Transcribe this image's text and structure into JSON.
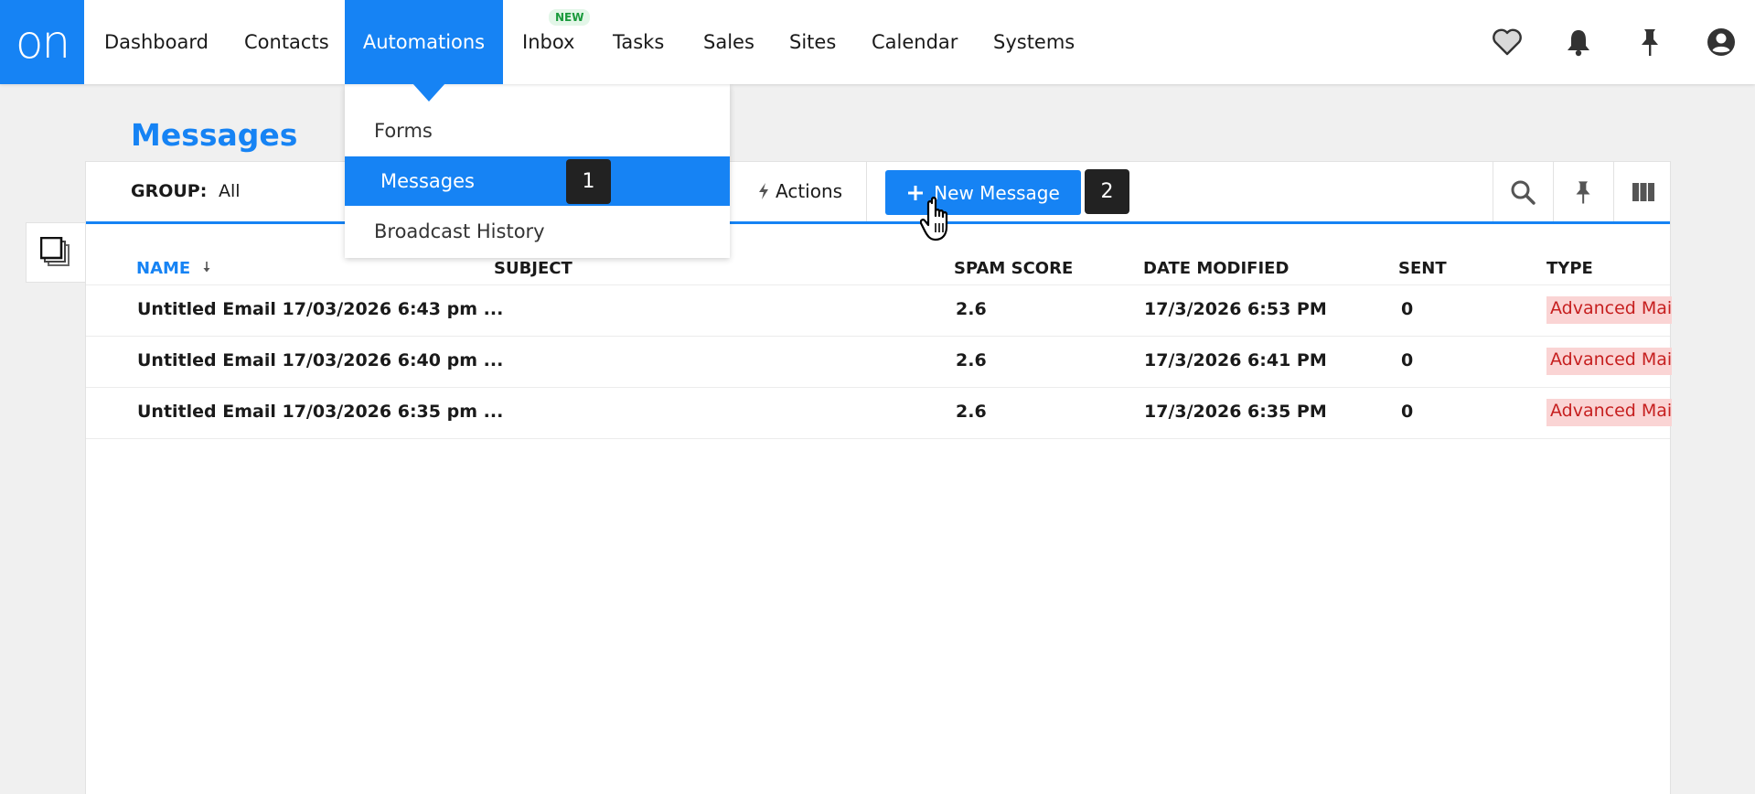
{
  "logo": {
    "text": "on"
  },
  "nav": {
    "items": [
      {
        "label": "Dashboard"
      },
      {
        "label": "Contacts"
      },
      {
        "label": "Automations"
      },
      {
        "label": "Inbox",
        "badge": "NEW"
      },
      {
        "label": "Tasks"
      },
      {
        "label": "Sales"
      },
      {
        "label": "Sites"
      },
      {
        "label": "Calendar"
      },
      {
        "label": "Systems"
      }
    ],
    "active": "Automations"
  },
  "top_icons": [
    "heart-icon",
    "bell-icon",
    "pin-icon",
    "account-icon"
  ],
  "dropdown": {
    "items": [
      {
        "label": "Forms"
      },
      {
        "label": "Messages"
      },
      {
        "label": "Broadcast History"
      }
    ],
    "active": "Messages"
  },
  "page": {
    "title": "Messages"
  },
  "toolbar": {
    "group_label": "GROUP:",
    "group_value": "All",
    "actions_label": "Actions",
    "new_message_label": "New Message"
  },
  "step_badges": {
    "one": "1",
    "two": "2"
  },
  "table": {
    "columns": [
      "NAME",
      "SUBJECT",
      "SPAM SCORE",
      "DATE MODIFIED",
      "SENT",
      "TYPE"
    ],
    "sorted_column": "NAME",
    "rows": [
      {
        "name": "Untitled Email 17/03/2026 6:43 pm ...",
        "subject": "",
        "spam_score": "2.6",
        "date_modified": "17/3/2026 6:53 PM",
        "sent": "0",
        "type": "Advanced Mail"
      },
      {
        "name": "Untitled Email 17/03/2026 6:40 pm ...",
        "subject": "",
        "spam_score": "2.6",
        "date_modified": "17/3/2026 6:41 PM",
        "sent": "0",
        "type": "Advanced Mail"
      },
      {
        "name": "Untitled Email 17/03/2026 6:35 pm ...",
        "subject": "",
        "spam_score": "2.6",
        "date_modified": "17/3/2026 6:35 PM",
        "sent": "0",
        "type": "Advanced Mail"
      }
    ]
  },
  "colors": {
    "accent": "#1683f4",
    "type_chip_bg": "#fad4d4",
    "type_chip_text": "#c61f1f",
    "new_badge": "#1a9a3c"
  }
}
